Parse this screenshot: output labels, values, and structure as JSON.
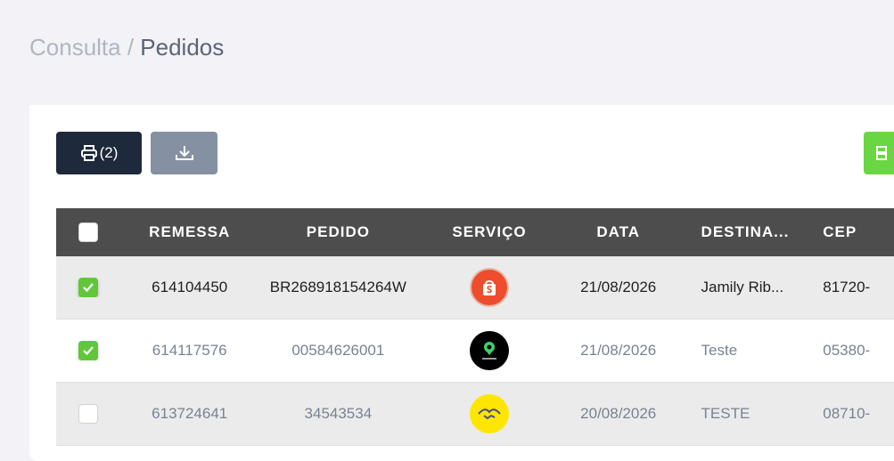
{
  "breadcrumb": {
    "parent": "Consulta",
    "separator": " / ",
    "current": "Pedidos"
  },
  "toolbar": {
    "print_label": "(2)"
  },
  "table": {
    "headers": {
      "remessa": "REMESSA",
      "pedido": "PEDIDO",
      "servico": "SERVIÇO",
      "data": "DATA",
      "destinatario": "DESTINA...",
      "cep": "CEP"
    },
    "rows": [
      {
        "checked": true,
        "remessa": "614104450",
        "pedido": "BR268918154264W",
        "servico": "shopee-logo",
        "data": "21/08/2026",
        "destinatario": "Jamily Rib...",
        "cep": "81720-"
      },
      {
        "checked": true,
        "remessa": "614117576",
        "pedido": "00584626001",
        "servico": "trackr-logo",
        "data": "21/08/2026",
        "destinatario": "Teste",
        "cep": "05380-"
      },
      {
        "checked": false,
        "remessa": "613724641",
        "pedido": "34543534",
        "servico": "handshake-logo",
        "data": "20/08/2026",
        "destinatario": "TESTE",
        "cep": "08710-"
      }
    ]
  },
  "colors": {
    "header_bg": "#4d4d4d",
    "print_btn": "#1e2a3c",
    "download_btn": "#8591a3",
    "green_btn": "#6bd643",
    "check_on": "#61c73a"
  }
}
